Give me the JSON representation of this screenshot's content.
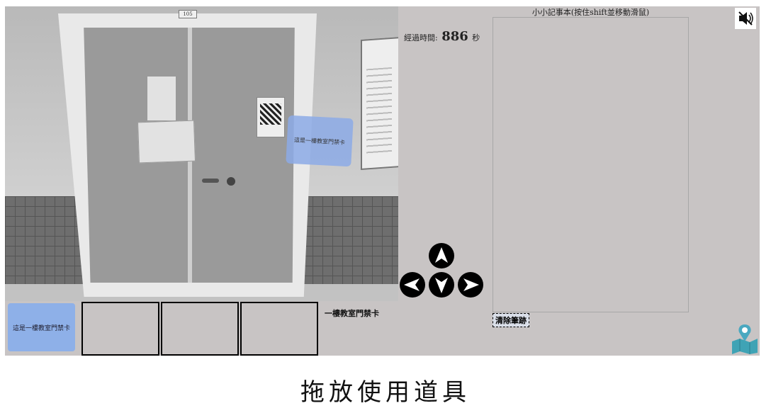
{
  "scene": {
    "room_number": "105",
    "card_text": "這是一樓教室門禁卡"
  },
  "timer": {
    "label": "經過時間:",
    "value": "886",
    "unit": "秒"
  },
  "notepad": {
    "title": "小小記事本(按住shift並移動滑鼠)",
    "clear_label": "清除筆跡"
  },
  "navigation": {
    "up": "arrow-up-icon",
    "down": "arrow-down-icon",
    "left": "arrow-left-icon",
    "right": "arrow-right-icon"
  },
  "inventory": {
    "selected_card_text": "這是一樓教室門禁卡",
    "selected_item_name": "一樓教室門禁卡",
    "slots": 3
  },
  "icons": {
    "sound": "speaker-mute-icon",
    "map": "map-pin-icon"
  },
  "caption": "拖放使用道具",
  "colors": {
    "panel": "#c8c4c4",
    "card": "#8eb0e8",
    "map_teal": "#3fa3b5"
  }
}
